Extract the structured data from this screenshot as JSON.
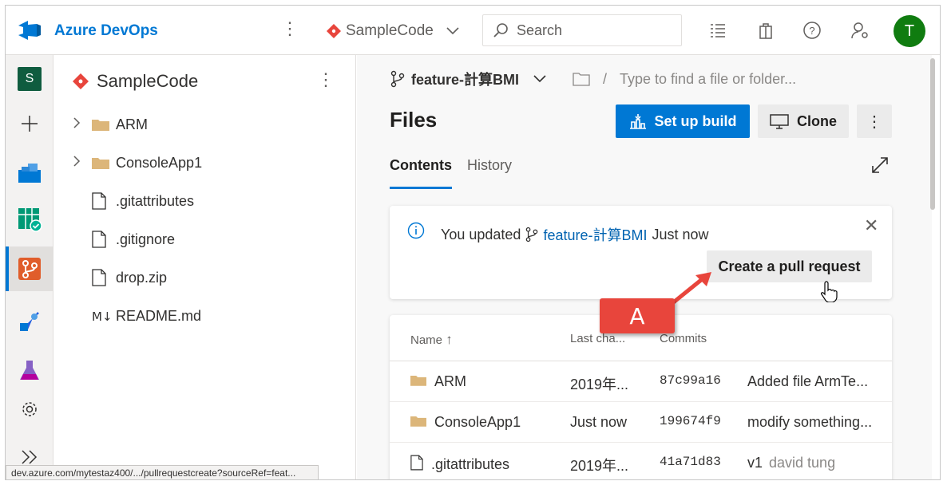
{
  "header": {
    "brand": "Azure DevOps",
    "project": "SampleCode",
    "search_placeholder": "Search",
    "avatar_initial": "T"
  },
  "rail": {
    "project_badge": "S"
  },
  "tree": {
    "repo_name": "SampleCode",
    "items": [
      {
        "label": "ARM",
        "type": "folder"
      },
      {
        "label": "ConsoleApp1",
        "type": "folder"
      },
      {
        "label": ".gitattributes",
        "type": "file"
      },
      {
        "label": ".gitignore",
        "type": "file"
      },
      {
        "label": "drop.zip",
        "type": "file"
      },
      {
        "label": "README.md",
        "type": "markdown"
      }
    ]
  },
  "main": {
    "branch": "feature-計算BMI",
    "path_placeholder": "Type to find a file or folder...",
    "path_separator": "/",
    "title": "Files",
    "setup_build_label": "Set up build",
    "clone_label": "Clone",
    "tabs": [
      {
        "label": "Contents",
        "active": true
      },
      {
        "label": "History",
        "active": false
      }
    ]
  },
  "banner": {
    "prefix": "You updated",
    "branch": "feature-計算BMI",
    "suffix": "Just now",
    "action_label": "Create a pull request"
  },
  "callout": {
    "label": "A"
  },
  "table": {
    "columns": [
      "Name",
      "Last cha...",
      "Commits"
    ],
    "rows": [
      {
        "name": "ARM",
        "type": "folder",
        "last_change": "2019年...",
        "commit": "87c99a16",
        "message": "Added file ArmTe...",
        "author": ""
      },
      {
        "name": "ConsoleApp1",
        "type": "folder",
        "last_change": "Just now",
        "commit": "199674f9",
        "message": "modify something...",
        "author": ""
      },
      {
        "name": ".gitattributes",
        "type": "file",
        "last_change": "2019年...",
        "commit": "41a71d83",
        "message": "v1",
        "author": "david tung"
      }
    ]
  },
  "status_url": "dev.azure.com/mytestaz400/.../pullrequestcreate?sourceRef=feat...",
  "colors": {
    "accent": "#0078d4",
    "callout": "#e8453c",
    "avatar": "#107c10"
  }
}
